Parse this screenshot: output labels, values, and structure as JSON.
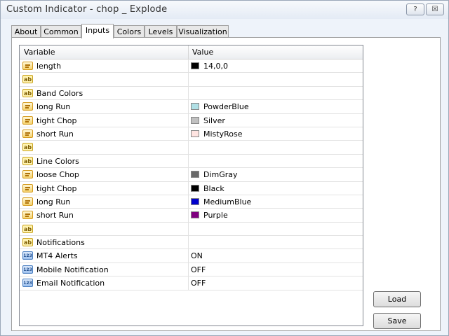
{
  "window": {
    "title": "Custom Indicator - chop _ Explode",
    "help_button": "?",
    "close_button": "☒"
  },
  "tabs": [
    {
      "label": "About"
    },
    {
      "label": "Common"
    },
    {
      "label": "Inputs",
      "active": true
    },
    {
      "label": "Colors"
    },
    {
      "label": "Levels"
    },
    {
      "label": "Visualization"
    }
  ],
  "grid": {
    "headers": {
      "variable": "Variable",
      "value": "Value"
    },
    "rows": [
      {
        "icon": "variable-icon",
        "name": "length",
        "value": "14,0,0",
        "color": "#000000"
      },
      {
        "icon": "ab-string-icon",
        "name": "",
        "value": ""
      },
      {
        "icon": "ab-string-icon",
        "name": "Band Colors",
        "value": ""
      },
      {
        "icon": "variable-icon",
        "name": "long Run",
        "value": "PowderBlue",
        "color": "#B0E0E6"
      },
      {
        "icon": "variable-icon",
        "name": "tight Chop",
        "value": "Silver",
        "color": "#C0C0C0"
      },
      {
        "icon": "variable-icon",
        "name": "short Run",
        "value": "MistyRose",
        "color": "#FFE4E1"
      },
      {
        "icon": "ab-string-icon",
        "name": "",
        "value": ""
      },
      {
        "icon": "ab-string-icon",
        "name": "Line Colors",
        "value": ""
      },
      {
        "icon": "variable-icon",
        "name": "loose Chop",
        "value": "DimGray",
        "color": "#696969"
      },
      {
        "icon": "variable-icon",
        "name": "tight Chop",
        "value": "Black",
        "color": "#000000"
      },
      {
        "icon": "variable-icon",
        "name": "long Run",
        "value": "MediumBlue",
        "color": "#0000CD"
      },
      {
        "icon": "variable-icon",
        "name": "short Run",
        "value": "Purple",
        "color": "#800080"
      },
      {
        "icon": "ab-string-icon",
        "name": "",
        "value": ""
      },
      {
        "icon": "ab-string-icon",
        "name": "Notifications",
        "value": ""
      },
      {
        "icon": "number-icon",
        "name": "MT4 Alerts",
        "value": "ON"
      },
      {
        "icon": "number-icon",
        "name": "Mobile Notification",
        "value": "OFF"
      },
      {
        "icon": "number-icon",
        "name": "Email Notification",
        "value": "OFF"
      }
    ]
  },
  "buttons": {
    "load": "Load",
    "save": "Save"
  }
}
